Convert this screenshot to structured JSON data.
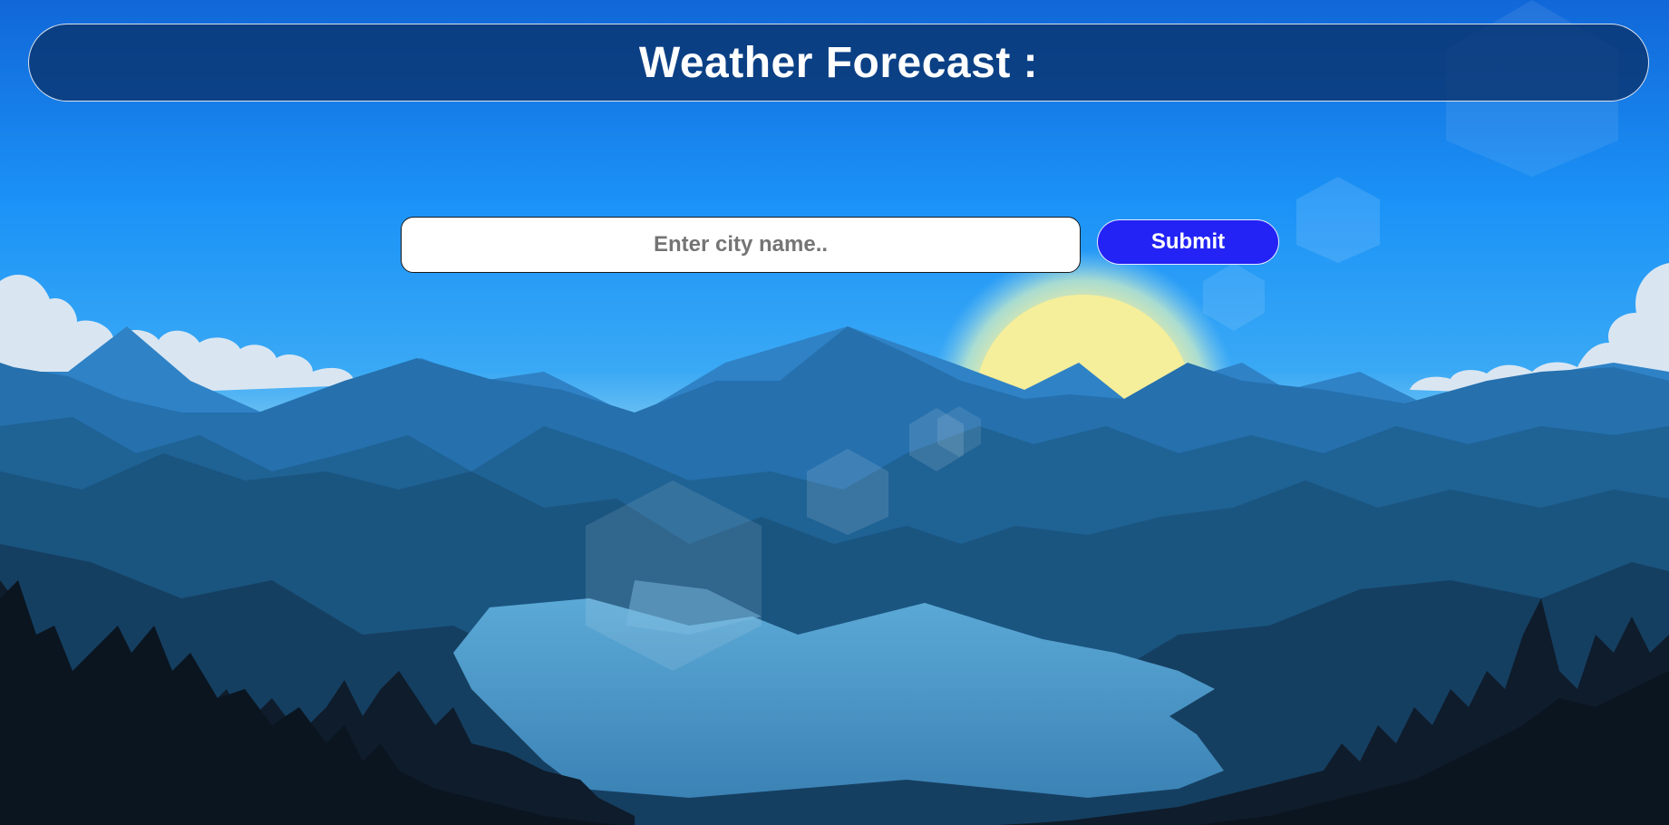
{
  "header": {
    "title": "Weather Forecast :"
  },
  "search": {
    "placeholder": "Enter city name..",
    "value": "",
    "submit_label": "Submit"
  },
  "theme": {
    "sky_top": "#1167d8",
    "sky_mid": "#1b93f7",
    "sky_horizon": "#8fd0f0",
    "sun": "#f5ee9a",
    "cloud": "#d9e6f2",
    "header_bg": "#0a3470",
    "button_bg": "#2323f5",
    "lake": "#4b9acb",
    "forest": "#0e1824"
  }
}
